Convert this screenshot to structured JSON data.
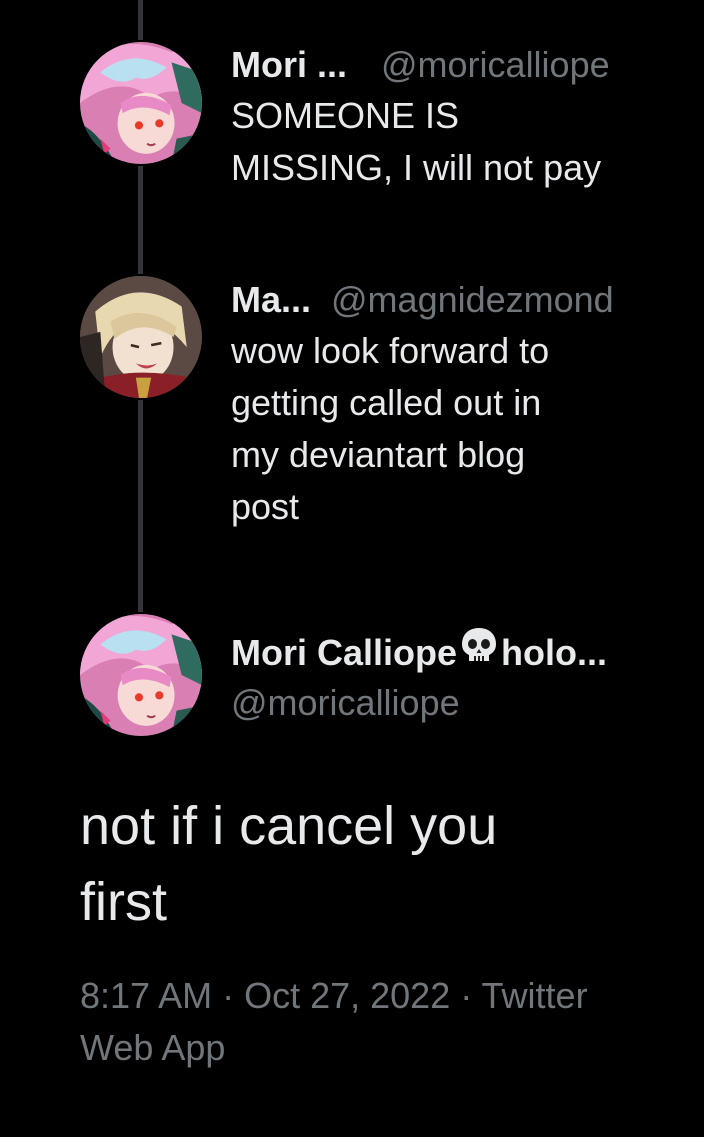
{
  "colors": {
    "background": "#000000",
    "text_primary": "#e7e9ea",
    "text_secondary": "#71767b",
    "thread_line": "#333639"
  },
  "replies": [
    {
      "display_name": "Mori ...",
      "handle": "@moricalliope",
      "text_lines": [
        "SOMEONE IS",
        "MISSING, I will not pay"
      ],
      "avatar_icon": "avatar-pink-hair"
    },
    {
      "display_name": "Ma...",
      "handle": "@magnidezmond",
      "text_lines": [
        "wow look forward to",
        "getting called out in",
        "my deviantart blog",
        "post"
      ],
      "avatar_icon": "avatar-blond-hair"
    }
  ],
  "main_tweet": {
    "display_name_part1": "Mori Calliope",
    "name_icon": "skull-icon",
    "display_name_part2": "holo...",
    "handle": "@moricalliope",
    "text_lines": [
      "not if i cancel you",
      "first"
    ],
    "meta_lines": [
      "8:17 AM · Oct 27, 2022 · Twitter",
      "Web App"
    ],
    "avatar_icon": "avatar-pink-hair"
  }
}
